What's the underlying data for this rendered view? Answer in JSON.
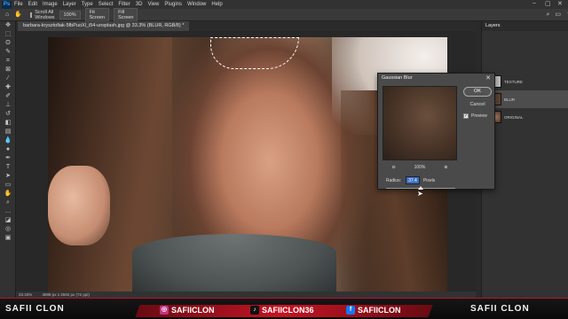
{
  "app": {
    "logo": "Ps"
  },
  "menu": [
    "File",
    "Edit",
    "Image",
    "Layer",
    "Type",
    "Select",
    "Filter",
    "3D",
    "View",
    "Plugins",
    "Window",
    "Help"
  ],
  "options_bar": {
    "scroll_all_label": "Scroll All Windows",
    "zoom_value": "100%",
    "fit_screen_label": "Fit Screen",
    "fill_screen_label": "Fill Screen"
  },
  "document_tab": {
    "title": "barbara-krysztofiak-5fbPuoXl_i54-unsplash.jpg @ 33.3% (BLUR, RGB/8) *"
  },
  "status_bar": {
    "zoom": "33.33%",
    "info": "3888 px x 2592 px (72 ppi)"
  },
  "layers_panel": {
    "title": "Layers",
    "layers": [
      {
        "name": "TEXTURE"
      },
      {
        "name": "BLUR"
      },
      {
        "name": "ORIGINAL"
      }
    ]
  },
  "gaussian_blur": {
    "title": "Gaussian Blur",
    "ok_label": "OK",
    "cancel_label": "Cancel",
    "preview_label": "Preview",
    "preview_checked": true,
    "zoom_value": "100%",
    "radius_label": "Radius:",
    "radius_value": "37.4",
    "radius_unit": "Pixels"
  },
  "footer": {
    "brand_left": "SAFII CLON",
    "brand_right": "SAFII CLON",
    "instagram": "SAFIICLON",
    "tiktok": "SAFIICLON36",
    "facebook": "SAFIICLON",
    "accent_color": "#c41424"
  }
}
